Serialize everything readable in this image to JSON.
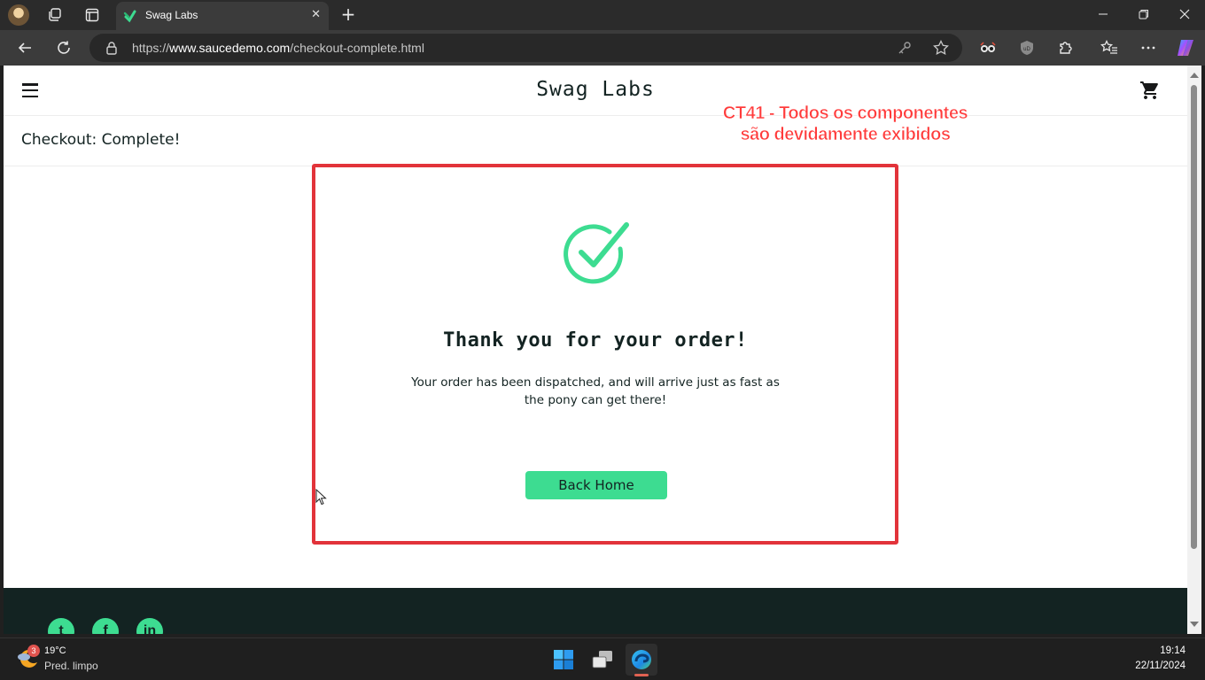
{
  "browser": {
    "tab": {
      "title": "Swag Labs",
      "favicon": "swag-labs-logo"
    },
    "url": {
      "scheme": "https://",
      "host": "www.saucedemo.com",
      "path": "/checkout-complete.html"
    }
  },
  "page": {
    "brand": "Swag Labs",
    "sub_title": "Checkout: Complete!",
    "complete_header": "Thank you for your order!",
    "complete_text": "Your order has been dispatched, and will arrive just as fast as the pony can get there!",
    "back_home_label": "Back Home",
    "social": {
      "twitter": "t",
      "facebook": "f",
      "linkedin": "in"
    },
    "accent_color": "#3ddc91",
    "text_color": "#132322",
    "footer_color": "#132322"
  },
  "annotation": {
    "line1": "CT41 - Todos os componentes",
    "line2": "são devidamente exibidos",
    "color": "#ff3b3b",
    "box_color": "#e2333a"
  },
  "taskbar": {
    "weather": {
      "temp": "19°C",
      "condition": "Pred. limpo",
      "badge": "3"
    },
    "clock": {
      "time": "19:14",
      "date": "22/11/2024"
    }
  }
}
